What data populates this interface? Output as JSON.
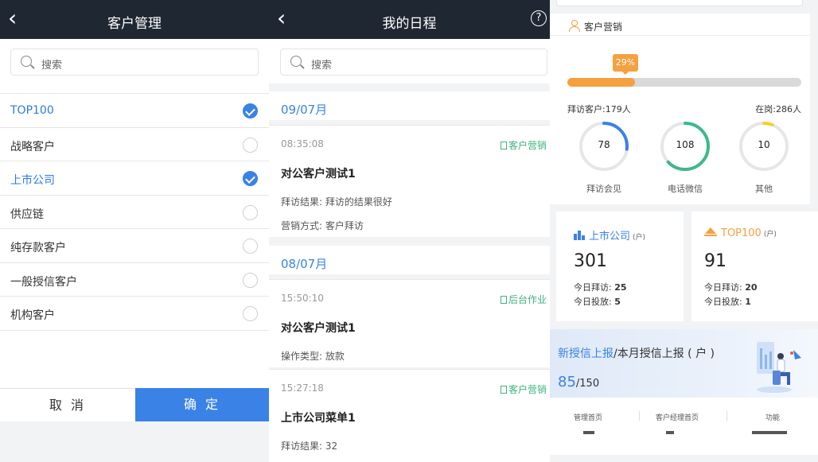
{
  "customer_mgmt": {
    "title": "客户管理",
    "search_placeholder": "搜索",
    "items": [
      {
        "label": "TOP100",
        "checked": true
      },
      {
        "label": "战略客户",
        "checked": false
      },
      {
        "label": "上市公司",
        "checked": true
      },
      {
        "label": "供应链",
        "checked": false
      },
      {
        "label": "纯存款客户",
        "checked": false
      },
      {
        "label": "一般授信客户",
        "checked": false
      },
      {
        "label": "机构客户",
        "checked": false
      }
    ],
    "cancel_label": "取 消",
    "confirm_label": "确 定"
  },
  "schedule": {
    "title": "我的日程",
    "search_placeholder": "搜索",
    "groups": [
      {
        "date": "09/07月",
        "entries": [
          {
            "time": "08:35:08",
            "tag": "客户营销",
            "title": "对公客户测试1",
            "line1": "拜访结果: 拜访的结果很好",
            "line2": "营销方式: 客户拜访"
          }
        ]
      },
      {
        "date": "08/07月",
        "entries": [
          {
            "time": "15:50:10",
            "tag": "后台作业",
            "title": "对公客户测试1",
            "line1": "操作类型: 放款",
            "line2": ""
          },
          {
            "time": "15:27:18",
            "tag": "客户营销",
            "title": "上市公司菜单1",
            "line1": "拜访结果: 32",
            "line2": ""
          }
        ]
      }
    ]
  },
  "dashboard": {
    "marketing": {
      "title": "客户营销",
      "progress_label": "29%",
      "progress_fraction": 0.29,
      "visited": "拜访客户:179人",
      "on_post": "在岗:286人",
      "rings": [
        {
          "value": "78",
          "label": "拜访会见",
          "color": "#3a82e6",
          "fraction": 0.27
        },
        {
          "value": "108",
          "label": "电话微信",
          "color": "#3cb98a",
          "fraction": 0.63
        },
        {
          "value": "10",
          "label": "其他",
          "color": "#f7cf2d",
          "fraction": 0.06
        }
      ]
    },
    "stats": [
      {
        "title": "上市公司",
        "unit": "(户)",
        "count": "301",
        "visit_label": "今日拜访: ",
        "visit": "25",
        "loan_label": "今日投放: ",
        "loan": "5",
        "color": "#3a82e6",
        "icon": "bank-icon"
      },
      {
        "title": "TOP100",
        "unit": "(户)",
        "count": "91",
        "visit_label": "今日拜访: ",
        "visit": "20",
        "loan_label": "今日投放: ",
        "loan": "1",
        "color": "#f5a041",
        "icon": "crown-icon"
      }
    ],
    "credit": {
      "title_a": "新授信上报",
      "title_b": "/本月授信上报 ( 户 )",
      "num": "85",
      "total": "/150"
    },
    "footer_nav": [
      "管理首页",
      "客户经理首页",
      "功能"
    ]
  }
}
